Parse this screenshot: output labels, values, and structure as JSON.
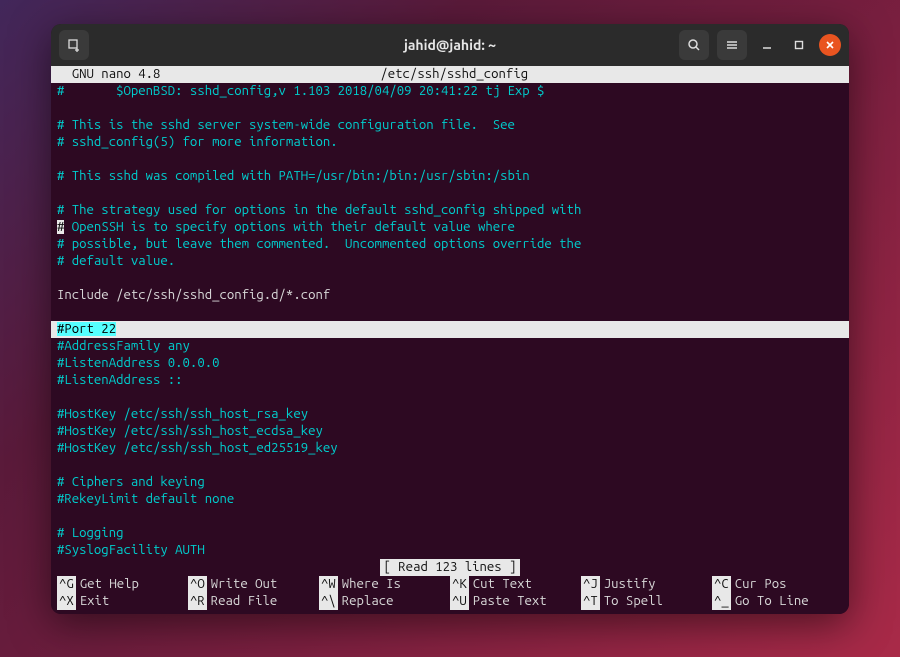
{
  "window": {
    "title": "jahid@jahid: ~"
  },
  "editor": {
    "header_left": "  GNU nano 4.8",
    "header_file": "/etc/ssh/sshd_config",
    "status_line": "[ Read 123 lines ]"
  },
  "content": {
    "l01": "#       $OpenBSD: sshd_config,v 1.103 2018/04/09 20:41:22 tj Exp $",
    "l02": "",
    "l03": "# This is the sshd server system-wide configuration file.  See",
    "l04": "# sshd_config(5) for more information.",
    "l05": "",
    "l06": "# This sshd was compiled with PATH=/usr/bin:/bin:/usr/sbin:/sbin",
    "l07": "",
    "l08": "# The strategy used for options in the default sshd_config shipped with",
    "l09_a": "#",
    "l09_b": " OpenSSH is to specify options with their default value where",
    "l10": "# possible, but leave them commented.  Uncommented options override the",
    "l11": "# default value.",
    "l12": "",
    "l13": "Include /etc/ssh/sshd_config.d/*.conf",
    "l14": "",
    "l15_hl": "#Port 22",
    "l16": "#AddressFamily any",
    "l17": "#ListenAddress 0.0.0.0",
    "l18": "#ListenAddress ::",
    "l19": "",
    "l20": "#HostKey /etc/ssh/ssh_host_rsa_key",
    "l21": "#HostKey /etc/ssh/ssh_host_ecdsa_key",
    "l22": "#HostKey /etc/ssh/ssh_host_ed25519_key",
    "l23": "",
    "l24": "# Ciphers and keying",
    "l25": "#RekeyLimit default none",
    "l26": "",
    "l27": "# Logging",
    "l28": "#SyslogFacility AUTH"
  },
  "shortcuts": {
    "row1": [
      {
        "key": "^G",
        "label": "Get Help"
      },
      {
        "key": "^O",
        "label": "Write Out"
      },
      {
        "key": "^W",
        "label": "Where Is"
      },
      {
        "key": "^K",
        "label": "Cut Text"
      },
      {
        "key": "^J",
        "label": "Justify"
      },
      {
        "key": "^C",
        "label": "Cur Pos"
      }
    ],
    "row2": [
      {
        "key": "^X",
        "label": "Exit"
      },
      {
        "key": "^R",
        "label": "Read File"
      },
      {
        "key": "^\\",
        "label": "Replace"
      },
      {
        "key": "^U",
        "label": "Paste Text"
      },
      {
        "key": "^T",
        "label": "To Spell"
      },
      {
        "key": "^_",
        "label": "Go To Line"
      }
    ]
  }
}
